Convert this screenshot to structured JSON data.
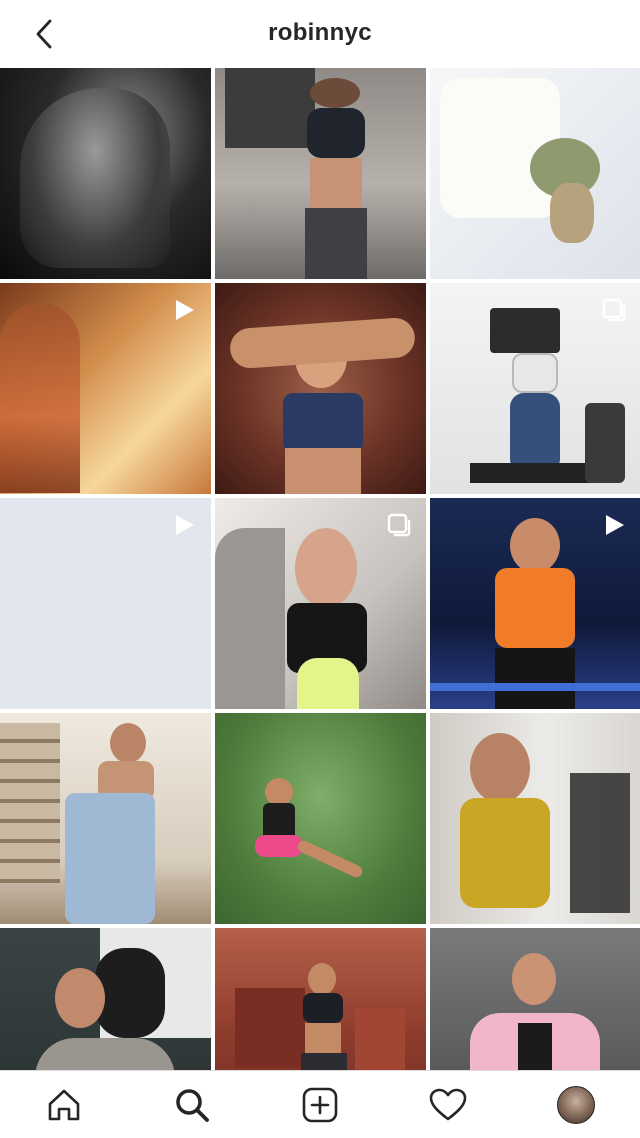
{
  "header": {
    "username": "robinnyc",
    "back_icon": "chevron-left-icon"
  },
  "grid": {
    "tiles": [
      {
        "badge": null,
        "colors": [
          "#111111",
          "#6b6b6b"
        ]
      },
      {
        "badge": null,
        "colors": [
          "#7f7a76",
          "#c9c2bd"
        ]
      },
      {
        "badge": null,
        "colors": [
          "#eef1f4",
          "#dfe3ea"
        ]
      },
      {
        "badge": "video-icon",
        "colors": [
          "#f0c07a",
          "#7a3c1c"
        ]
      },
      {
        "badge": null,
        "colors": [
          "#5e2f25",
          "#a56a52"
        ]
      },
      {
        "badge": "carousel-icon",
        "colors": [
          "#f4f4f4",
          "#d9d9d9"
        ]
      },
      {
        "badge": "video-icon",
        "colors": [
          "#e3e7ee",
          "#e3e7ee"
        ]
      },
      {
        "badge": "carousel-icon",
        "colors": [
          "#e9dfd9",
          "#b8aaa2"
        ]
      },
      {
        "badge": "video-icon",
        "colors": [
          "#0d1a3a",
          "#2a3d78"
        ]
      },
      {
        "badge": null,
        "colors": [
          "#e9e2d7",
          "#a89884"
        ]
      },
      {
        "badge": null,
        "colors": [
          "#4f7a3a",
          "#6ea25a"
        ]
      },
      {
        "badge": null,
        "colors": [
          "#e8e6e3",
          "#cfcac4"
        ]
      },
      {
        "badge": null,
        "colors": [
          "#2f3a3a",
          "#7c6f66"
        ]
      },
      {
        "badge": null,
        "colors": [
          "#b15a45",
          "#7a3326"
        ]
      },
      {
        "badge": null,
        "colors": [
          "#6f6f6f",
          "#3d3d3d"
        ]
      }
    ]
  },
  "bottom_nav": {
    "items": [
      "home-icon",
      "search-icon",
      "new-post-icon",
      "activity-heart-icon",
      "profile-avatar"
    ],
    "active": "search-icon"
  }
}
